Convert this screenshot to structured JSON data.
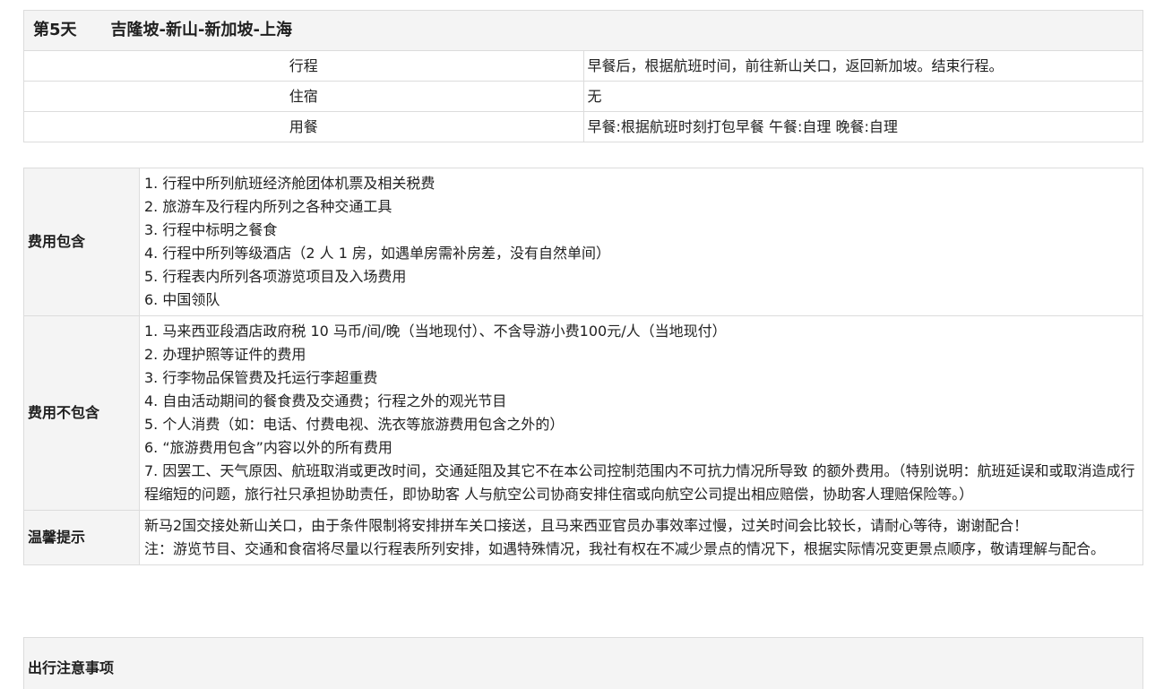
{
  "day": {
    "number": "第5天",
    "route": "吉隆坡-新山-新加坡-上海",
    "rows": [
      {
        "label": "行程",
        "value": "早餐后，根据航班时间，前往新山关口，返回新加坡。结束行程。"
      },
      {
        "label": "住宿",
        "value": "无"
      },
      {
        "label": "用餐",
        "value": "早餐:根据航班时刻打包早餐  午餐:自理  晚餐:自理"
      }
    ]
  },
  "cost": {
    "included": {
      "label": "费用包含",
      "items": [
        "1. 行程中所列航班经济舱团体机票及相关税费",
        "2. 旅游车及行程内所列之各种交通工具",
        "3. 行程中标明之餐食",
        "4. 行程中所列等级酒店（2 人 1 房，如遇单房需补房差，没有自然单间）",
        "5. 行程表内所列各项游览项目及入场费用",
        "6. 中国领队"
      ]
    },
    "excluded": {
      "label": "费用不包含",
      "items": [
        "1. 马来西亚段酒店政府税 10 马币/间/晚（当地现付）、不含导游小费100元/人（当地现付）",
        "2. 办理护照等证件的费用",
        "3. 行李物品保管费及托运行李超重费",
        "4. 自由活动期间的餐食费及交通费；行程之外的观光节目",
        "5. 个人消费（如：电话、付费电视、洗衣等旅游费用包含之外的）",
        "6. “旅游费用包含”内容以外的所有费用",
        "7. 因罢工、天气原因、航班取消或更改时间，交通延阻及其它不在本公司控制范围内不可抗力情况所导致 的额外费用。（特别说明：航班延误和或取消造成行程缩短的问题，旅行社只承担协助责任，即协助客 人与航空公司协商安排住宿或向航空公司提出相应赔偿，协助客人理赔保险等。）"
      ]
    },
    "tips": {
      "label": "温馨提示",
      "items": [
        "新马2国交接处新山关口，由于条件限制将安排拼车关口接送，且马来西亚官员办事效率过慢，过关时间会比较长，请耐心等待，谢谢配合！",
        "注：游览节目、交通和食宿将尽量以行程表所列安排，如遇特殊情况，我社有权在不减少景点的情况下，根据实际情况变更景点顺序，敬请理解与配合。"
      ]
    }
  },
  "notes": {
    "title": "出行注意事项"
  }
}
